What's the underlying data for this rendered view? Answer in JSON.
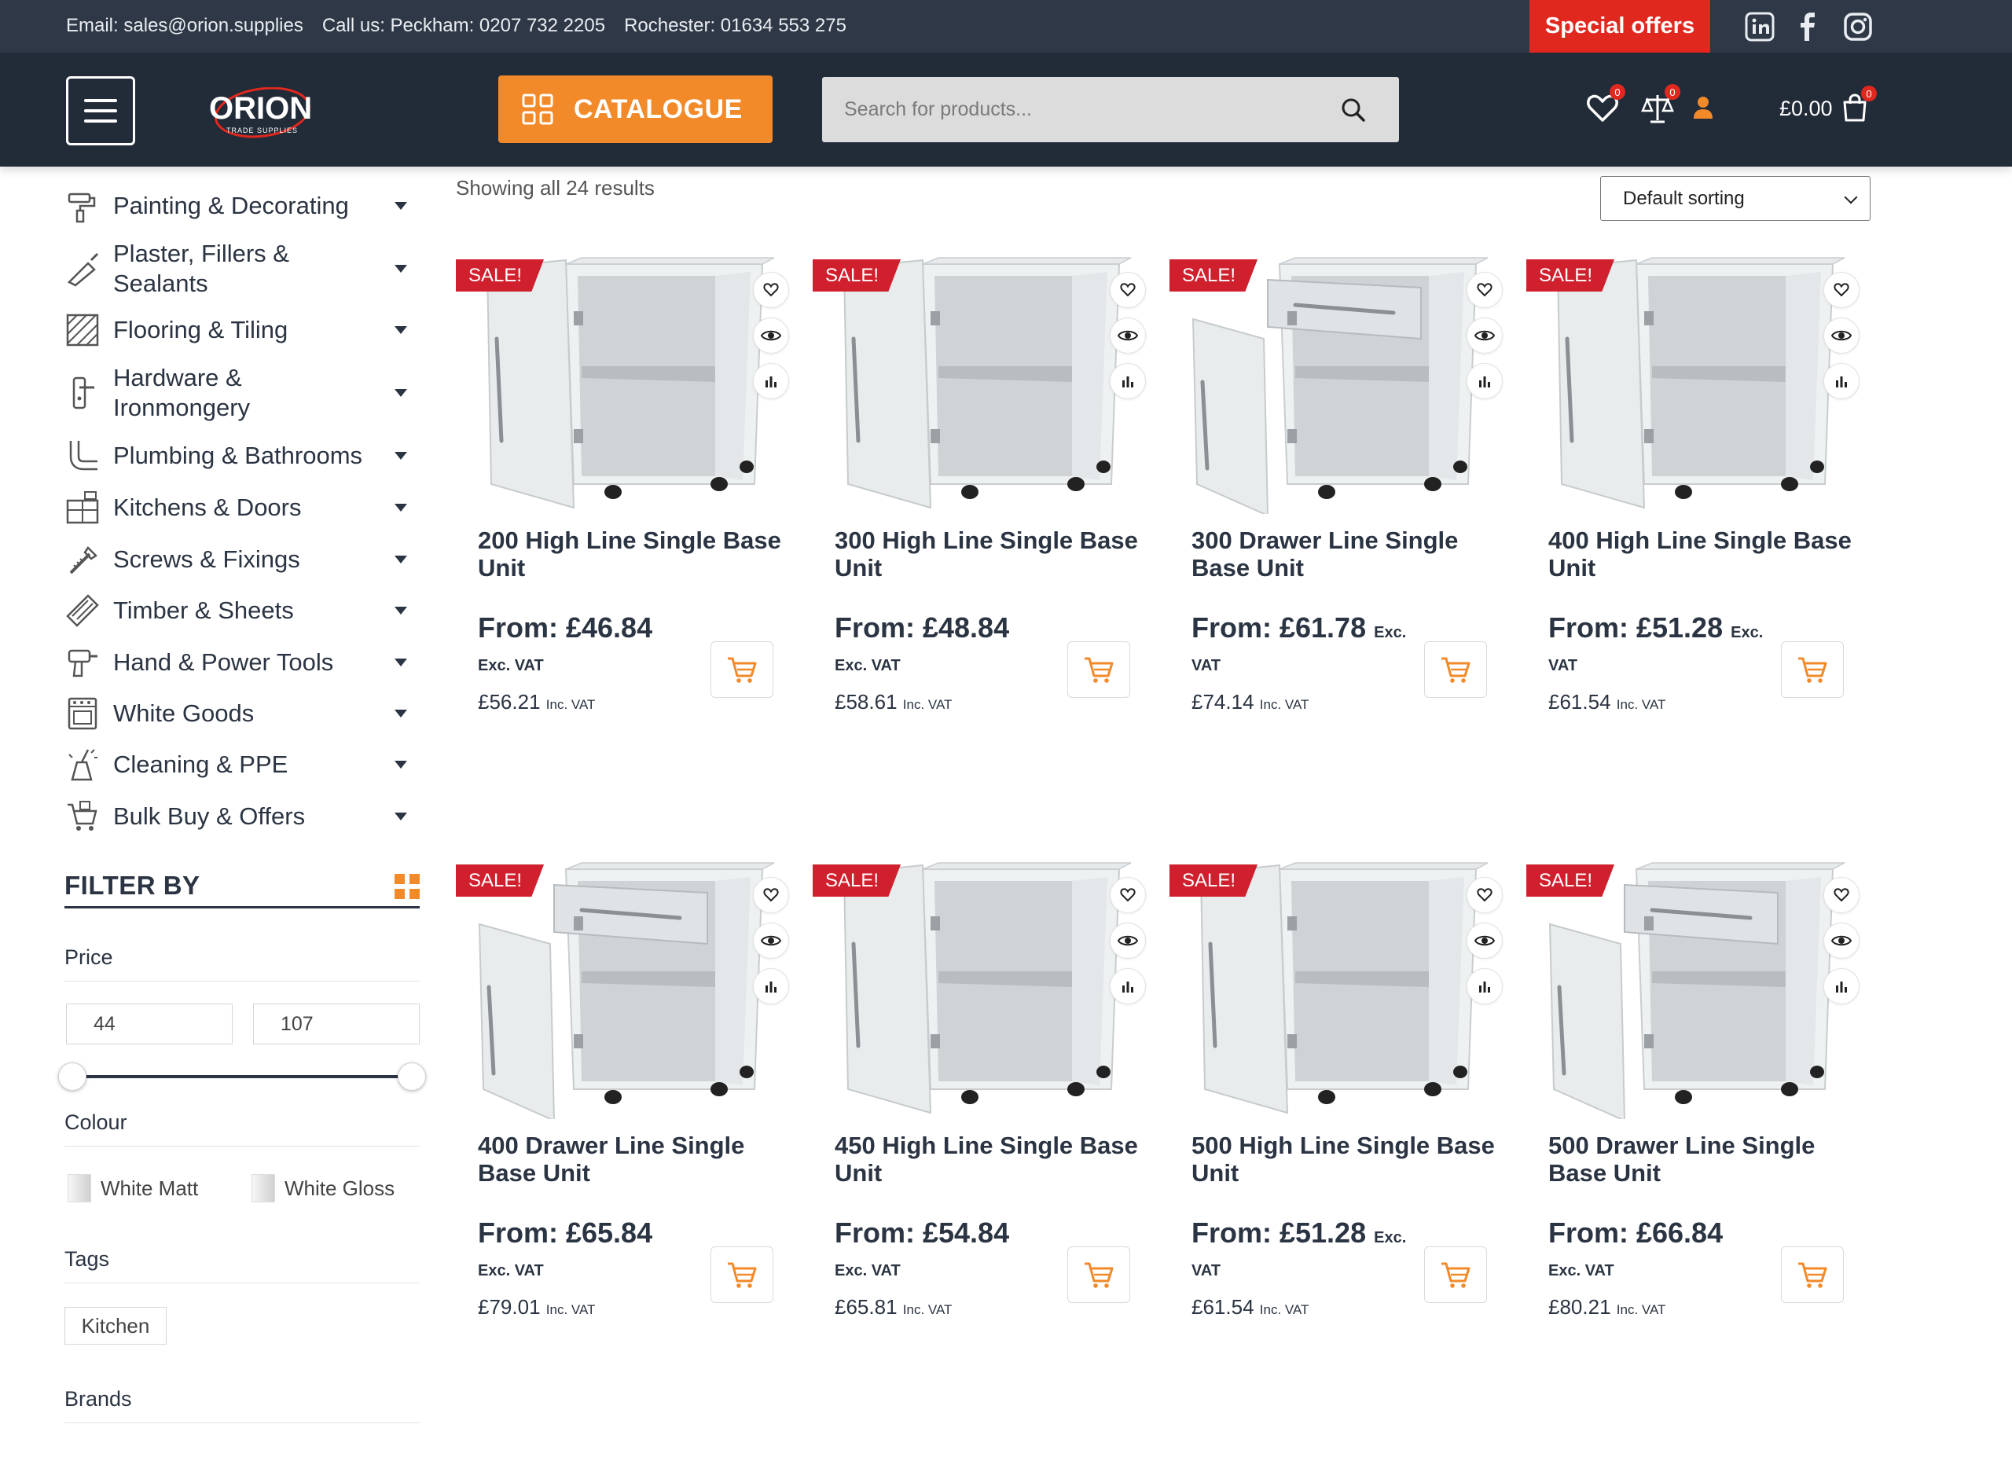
{
  "topbar": {
    "email": "Email: sales@orion.supplies",
    "call": "Call us: Peckham: 0207 732 2205",
    "rochester": "Rochester: 01634 553 275",
    "special_offers": "Special offers"
  },
  "header": {
    "logo_text": "ORION",
    "logo_sub": "TRADE SUPPLIES",
    "catalogue": "CATALOGUE",
    "search_placeholder": "Search for products...",
    "wishlist_count": "0",
    "compare_count": "0",
    "cart_count": "0",
    "cart_total": "£0.00"
  },
  "categories": [
    {
      "label": "Painting & Decorating",
      "icon": "paint-roller-icon"
    },
    {
      "label": "Plaster, Fillers & Sealants",
      "icon": "trowel-icon"
    },
    {
      "label": "Flooring & Tiling",
      "icon": "tiles-icon"
    },
    {
      "label": "Hardware & Ironmongery",
      "icon": "door-handle-icon"
    },
    {
      "label": "Plumbing & Bathrooms",
      "icon": "pipe-icon"
    },
    {
      "label": "Kitchens & Doors",
      "icon": "kitchen-icon"
    },
    {
      "label": "Screws & Fixings",
      "icon": "screw-icon"
    },
    {
      "label": "Timber & Sheets",
      "icon": "timber-icon"
    },
    {
      "label": "Hand & Power Tools",
      "icon": "drill-icon"
    },
    {
      "label": "White Goods",
      "icon": "oven-icon"
    },
    {
      "label": "Cleaning & PPE",
      "icon": "cleaning-icon"
    },
    {
      "label": "Bulk Buy & Offers",
      "icon": "cart-offers-icon"
    }
  ],
  "filters": {
    "title": "FILTER BY",
    "price_label": "Price",
    "price_min": "44",
    "price_max": "107",
    "colour_label": "Colour",
    "colours": [
      "White Matt",
      "White Gloss"
    ],
    "tags_label": "Tags",
    "tags": [
      "Kitchen"
    ],
    "brands_label": "Brands"
  },
  "results": {
    "showing": "Showing all 24 results",
    "sorting": "Default sorting"
  },
  "products": [
    {
      "sale": "SALE!",
      "title": "200 High Line Single Base Unit",
      "price": "From: £46.84",
      "inline_exc": "",
      "exc": "Exc. VAT",
      "inc": "£56.21",
      "inc_label": "Inc. VAT",
      "variant": "door"
    },
    {
      "sale": "SALE!",
      "title": "300 High Line Single Base Unit",
      "price": "From: £48.84",
      "inline_exc": "",
      "exc": "Exc. VAT",
      "inc": "£58.61",
      "inc_label": "Inc. VAT",
      "variant": "door"
    },
    {
      "sale": "SALE!",
      "title": "300 Drawer Line Single Base Unit",
      "price": "From: £61.78",
      "inline_exc": "Exc.",
      "exc": "VAT",
      "inc": "£74.14",
      "inc_label": "Inc. VAT",
      "variant": "drawer"
    },
    {
      "sale": "SALE!",
      "title": "400 High Line Single Base Unit",
      "price": "From: £51.28",
      "inline_exc": "Exc.",
      "exc": "VAT",
      "inc": "£61.54",
      "inc_label": "Inc. VAT",
      "variant": "door"
    },
    {
      "sale": "SALE!",
      "title": "400 Drawer Line Single Base Unit",
      "price": "From: £65.84",
      "inline_exc": "",
      "exc": "Exc. VAT",
      "inc": "£79.01",
      "inc_label": "Inc. VAT",
      "variant": "drawer"
    },
    {
      "sale": "SALE!",
      "title": "450 High Line Single Base Unit",
      "price": "From: £54.84",
      "inline_exc": "",
      "exc": "Exc. VAT",
      "inc": "£65.81",
      "inc_label": "Inc. VAT",
      "variant": "door"
    },
    {
      "sale": "SALE!",
      "title": "500 High Line Single Base Unit",
      "price": "From: £51.28",
      "inline_exc": "Exc.",
      "exc": "VAT",
      "inc": "£61.54",
      "inc_label": "Inc. VAT",
      "variant": "door"
    },
    {
      "sale": "SALE!",
      "title": "500 Drawer Line Single Base Unit",
      "price": "From: £66.84",
      "inline_exc": "",
      "exc": "Exc. VAT",
      "inc": "£80.21",
      "inc_label": "Inc. VAT",
      "variant": "drawer"
    }
  ],
  "colors": {
    "topbar": "#2f3846",
    "header": "#222b38",
    "accent_orange": "#f28a2a",
    "sale_red": "#d0202e",
    "special_red": "#e0281f",
    "text_dark": "#2b3442"
  }
}
